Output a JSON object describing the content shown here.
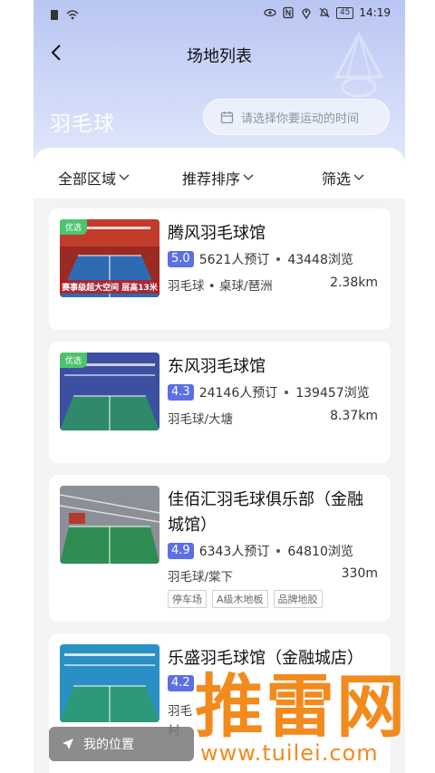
{
  "status_bar": {
    "time": "14:19",
    "battery": "45"
  },
  "nav": {
    "title": "场地列表"
  },
  "sport": {
    "title": "羽毛球",
    "time_placeholder": "请选择你要运动的时间"
  },
  "filters": {
    "area": "全部区域",
    "sort": "推荐排序",
    "filter": "筛选"
  },
  "venues": [
    {
      "name": "腾风羽毛球馆",
      "score": "5.0",
      "bookings": "5621人预订",
      "views": "43448浏览",
      "tags": "羽毛球 • 桌球/琶洲",
      "distance": "2.38km",
      "badge": "优选",
      "thumb_caption": "赛事级超大空间  层高13米",
      "thumb_colors": [
        "#c2332a",
        "#2f6bb3"
      ]
    },
    {
      "name": "东风羽毛球馆",
      "score": "4.3",
      "bookings": "24146人预订",
      "views": "139457浏览",
      "tags": "羽毛球/大塘",
      "distance": "8.37km",
      "badge": "优选",
      "thumb_colors": [
        "#3d4fa0",
        "#2f8a6a"
      ]
    },
    {
      "name_line1": "佳佰汇羽毛球俱乐部（金融",
      "name_line2": "城馆）",
      "score": "4.9",
      "bookings": "6343人预订",
      "views": "64810浏览",
      "tags": "羽毛球/棠下",
      "distance": "330m",
      "chips": [
        "停车场",
        "A级木地板",
        "品牌地胶"
      ],
      "thumb_colors": [
        "#8b8f96",
        "#2f8c52"
      ]
    },
    {
      "name": "乐盛羽毛球馆（金融城店）",
      "score": "4.2",
      "tags_partial": "羽毛",
      "tags_partial2": "村",
      "thumb_colors": [
        "#2a8fc4",
        "#2c9a78"
      ]
    }
  ],
  "my_location": "我的位置",
  "watermark": {
    "big": "推雷网",
    "small": "www.tuilei.com"
  }
}
